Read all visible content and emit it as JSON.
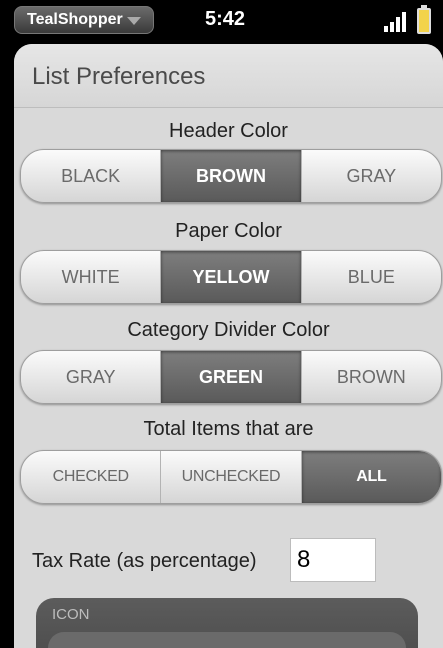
{
  "status_bar": {
    "app_name": "TealShopper",
    "time": "5:42"
  },
  "page": {
    "title": "List Preferences"
  },
  "header_color": {
    "label": "Header Color",
    "options": [
      "BLACK",
      "BROWN",
      "GRAY"
    ],
    "selected": "BROWN"
  },
  "paper_color": {
    "label": "Paper Color",
    "options": [
      "WHITE",
      "YELLOW",
      "BLUE"
    ],
    "selected": "YELLOW"
  },
  "divider_color": {
    "label": "Category Divider Color",
    "options": [
      "GRAY",
      "GREEN",
      "BROWN"
    ],
    "selected": "GREEN"
  },
  "total_items": {
    "label": "Total Items that are",
    "options": [
      "CHECKED",
      "UNCHECKED",
      "ALL"
    ],
    "selected": "ALL"
  },
  "tax": {
    "label": "Tax Rate (as percentage)",
    "value": "8"
  },
  "icon_group": {
    "label": "ICON"
  }
}
